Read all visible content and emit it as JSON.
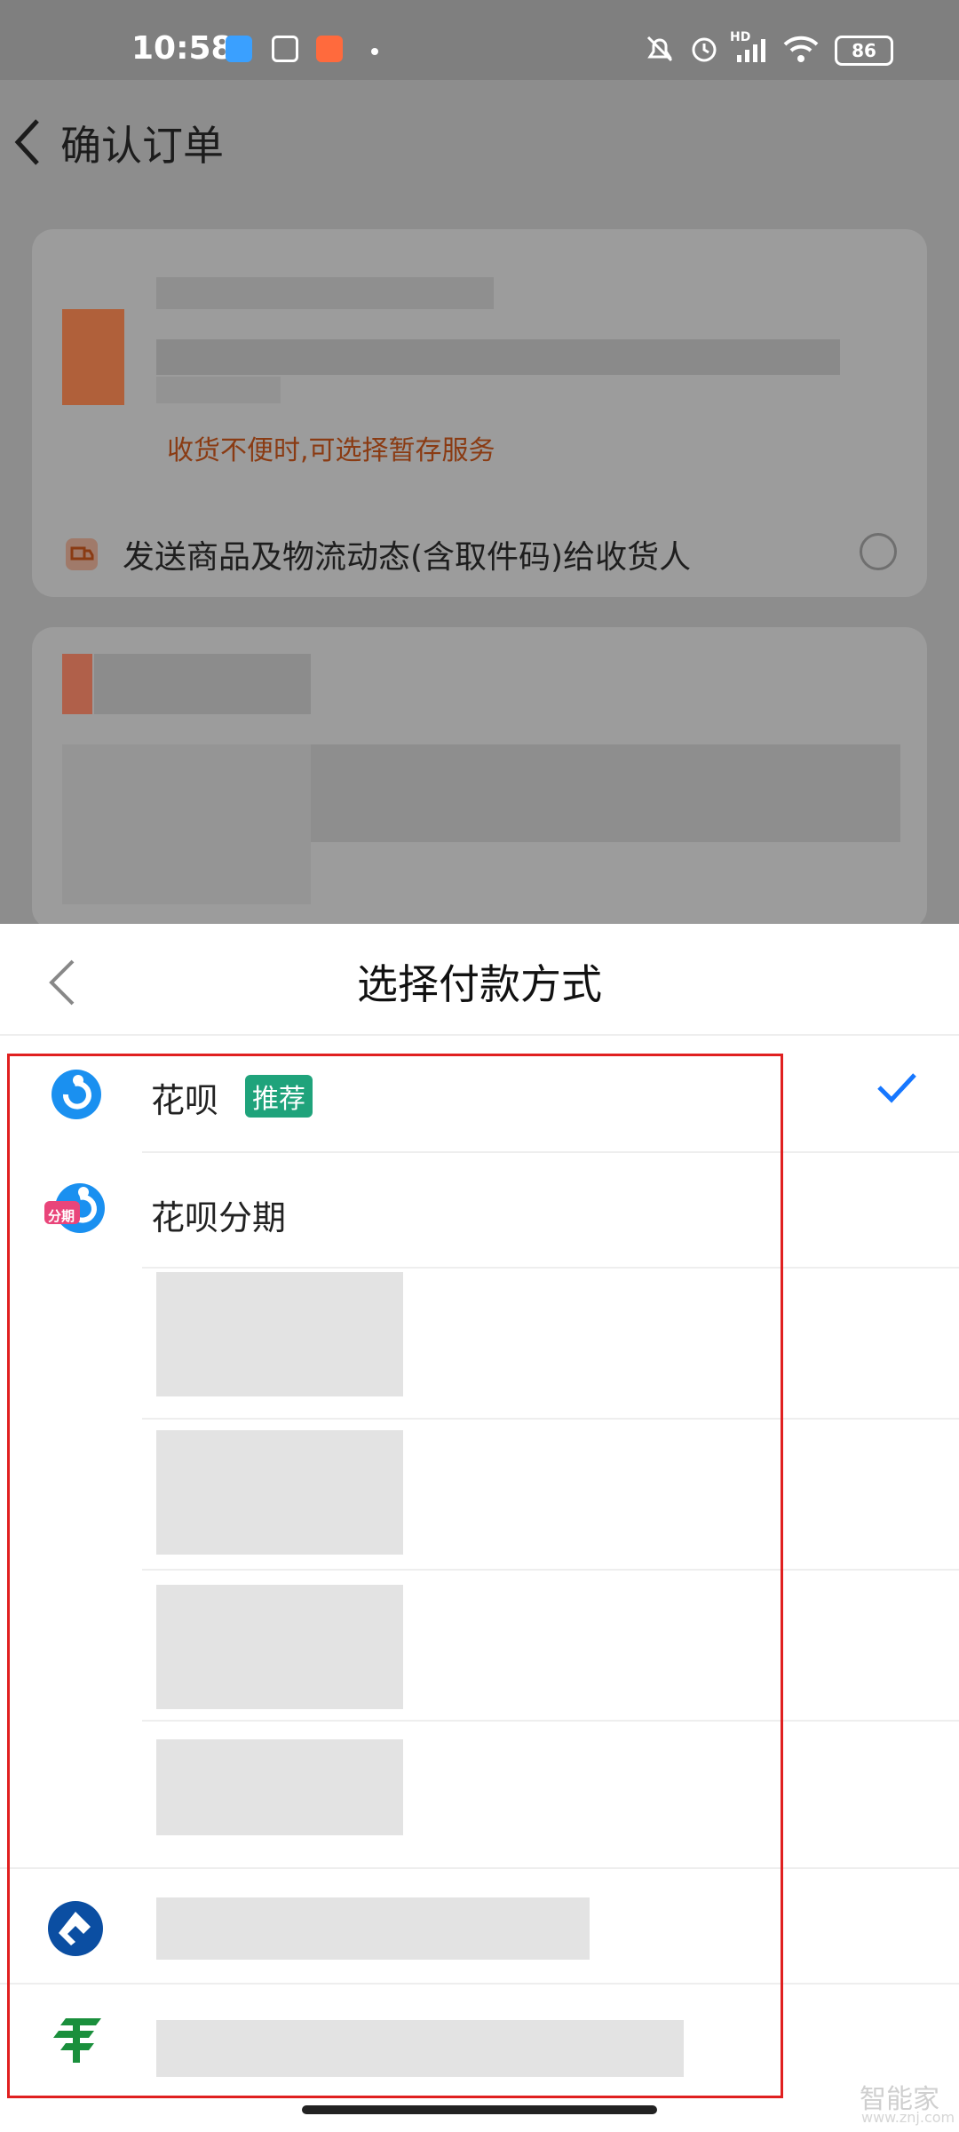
{
  "status_bar": {
    "time": "10:58",
    "battery": "86",
    "network": "HD"
  },
  "page": {
    "title": "确认订单",
    "store_tip": "收货不便时,可选择暂存服务",
    "send_logistics_text": "发送商品及物流动态(含取件码)给收货人"
  },
  "sheet": {
    "title": "选择付款方式",
    "methods": [
      {
        "label": "花呗",
        "tag": "推荐",
        "selected": true,
        "icon": "huabei-icon"
      },
      {
        "label": "花呗分期",
        "icon": "huabei-installment-icon",
        "icon_text": "分期"
      }
    ],
    "bank_icons": [
      "ccb-bank-icon",
      "postal-bank-icon"
    ]
  },
  "watermark": {
    "text": "智能家",
    "url_text": "www.znj.com"
  },
  "colors": {
    "accent_blue": "#1677ff",
    "tag_green": "#1fa37b",
    "warning_text": "#8a3b13",
    "highlight_red": "#e02020"
  }
}
